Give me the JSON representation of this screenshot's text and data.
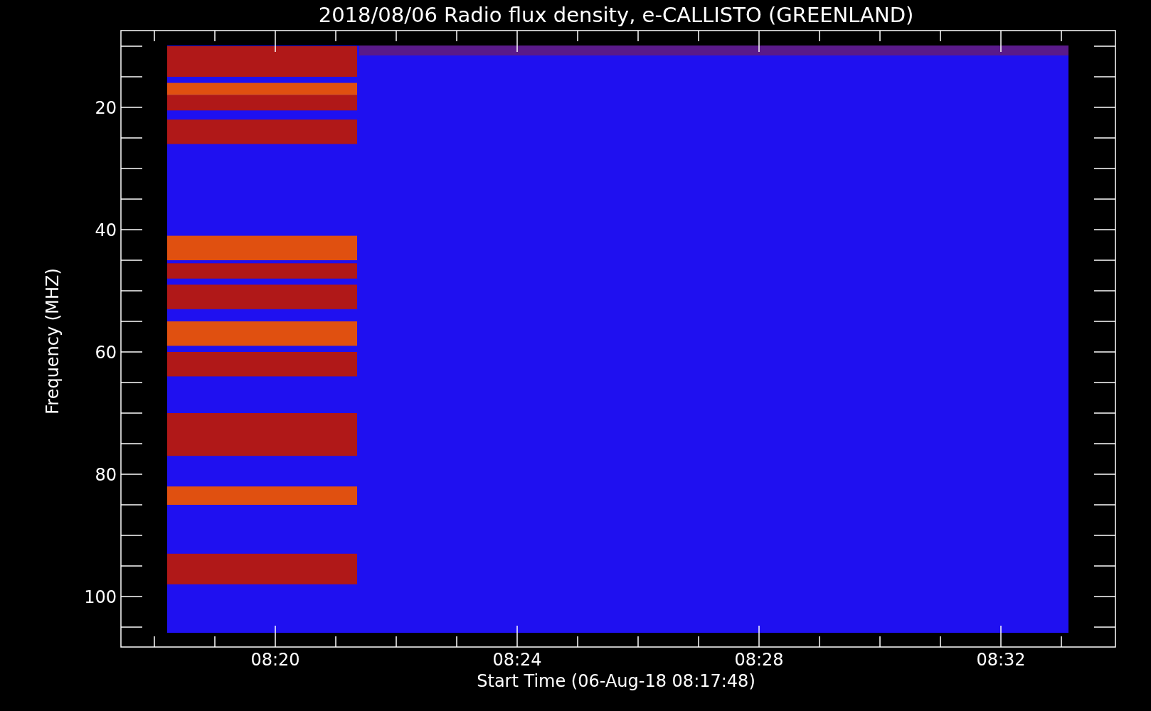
{
  "title": "2018/08/06  Radio flux density, e-CALLISTO (GREENLAND)",
  "y_axis": {
    "label": "Frequency (MHZ)",
    "ticks": [
      "20",
      "40",
      "60",
      "80",
      "100"
    ]
  },
  "x_axis": {
    "label": "Start Time (06-Aug-18 08:17:48)",
    "ticks": [
      "08:20",
      "08:24",
      "08:28",
      "08:32"
    ]
  }
}
